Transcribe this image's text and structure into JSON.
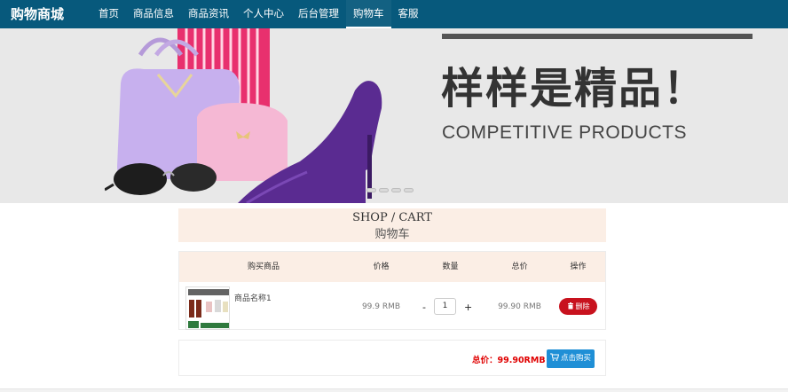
{
  "brand": "购物商城",
  "nav": [
    {
      "label": "首页",
      "active": false
    },
    {
      "label": "商品信息",
      "active": false
    },
    {
      "label": "商品资讯",
      "active": false
    },
    {
      "label": "个人中心",
      "active": false
    },
    {
      "label": "后台管理",
      "active": false
    },
    {
      "label": "购物车",
      "active": true
    },
    {
      "label": "客服",
      "active": false
    }
  ],
  "banner": {
    "heading": "样样是精品！",
    "subheading": "COMPETITIVE PRODUCTS",
    "slide_count": 4
  },
  "cart": {
    "title_en": "SHOP / CART",
    "title_cn": "购物车",
    "headers": [
      "购买商品",
      "价格",
      "数量",
      "总价",
      "操作"
    ],
    "items": [
      {
        "name": "商品名称1",
        "price": "99.9 RMB",
        "quantity": "1",
        "subtotal": "99.90 RMB",
        "delete_label": "删除"
      }
    ],
    "decrease_label": "-",
    "increase_label": "+",
    "total": "总价：99.90RMB",
    "buy_label": "点击购买"
  },
  "colors": {
    "navbar": "#07597c",
    "header_bg": "#fbeee5",
    "delete": "#c8121e",
    "buy": "#1f8fd6",
    "total_text": "#e00000"
  },
  "icons": {
    "delete": "trash-icon",
    "buy": "cart-icon"
  }
}
